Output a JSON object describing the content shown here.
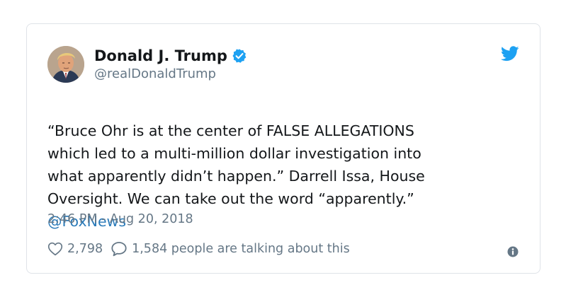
{
  "tweet": {
    "author_name": "Donald J. Trump",
    "author_handle": "@realDonaldTrump",
    "text_lines": [
      "“Bruce Ohr is at the center of FALSE ALLEGATIONS",
      "which led to a multi-million dollar investigation into",
      "what apparently didn’t happen.” Darrell Issa, House",
      "Oversight. We can take out the word “apparently.”"
    ],
    "mention": "@FoxNews",
    "timestamp": "2:46 PM - Aug 20, 2018",
    "like_count": "2,798",
    "talking_text": "1,584 people are talking about this"
  },
  "icons": {
    "verified": "verified-badge-icon",
    "brand": "twitter-bird-icon",
    "like": "heart-icon",
    "reply": "speech-bubble-icon",
    "info": "info-icon"
  },
  "colors": {
    "text": "#14171a",
    "secondary": "#657786",
    "link": "#2b7bb9",
    "brand": "#1da1f2",
    "border": "#dfe3e8"
  }
}
